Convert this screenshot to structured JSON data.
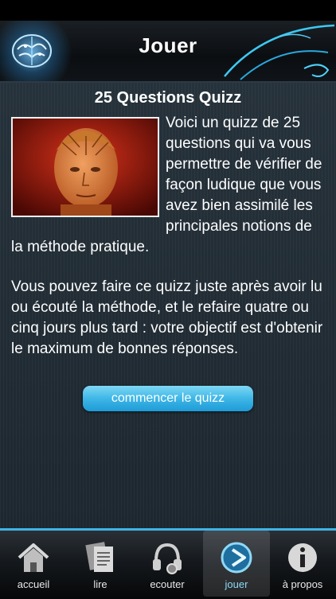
{
  "header": {
    "title": "Jouer"
  },
  "content": {
    "title": "25 Questions Quizz",
    "intro_text": "Voici un quizz de 25 questions qui va vous permettre de vérifier de façon ludique que vous avez bien assimilé les principales notions de la méthode pratique.",
    "paragraph_2": "Vous pouvez faire ce quizz juste après avoir lu ou écouté la méthode, et le refaire quatre ou cinq jours plus tard : votre objectif est d'obtenir le maximum de bonnes réponses.",
    "start_button": "commencer le quizz"
  },
  "tabbar": {
    "tabs": [
      {
        "label": "accueil",
        "icon": "home-icon"
      },
      {
        "label": "lire",
        "icon": "document-icon"
      },
      {
        "label": "ecouter",
        "icon": "headphones-icon"
      },
      {
        "label": "jouer",
        "icon": "play-icon",
        "active": true
      },
      {
        "label": "à propos",
        "icon": "info-icon"
      }
    ]
  },
  "colors": {
    "accent": "#3fb4e6",
    "background": "#1e2830"
  }
}
